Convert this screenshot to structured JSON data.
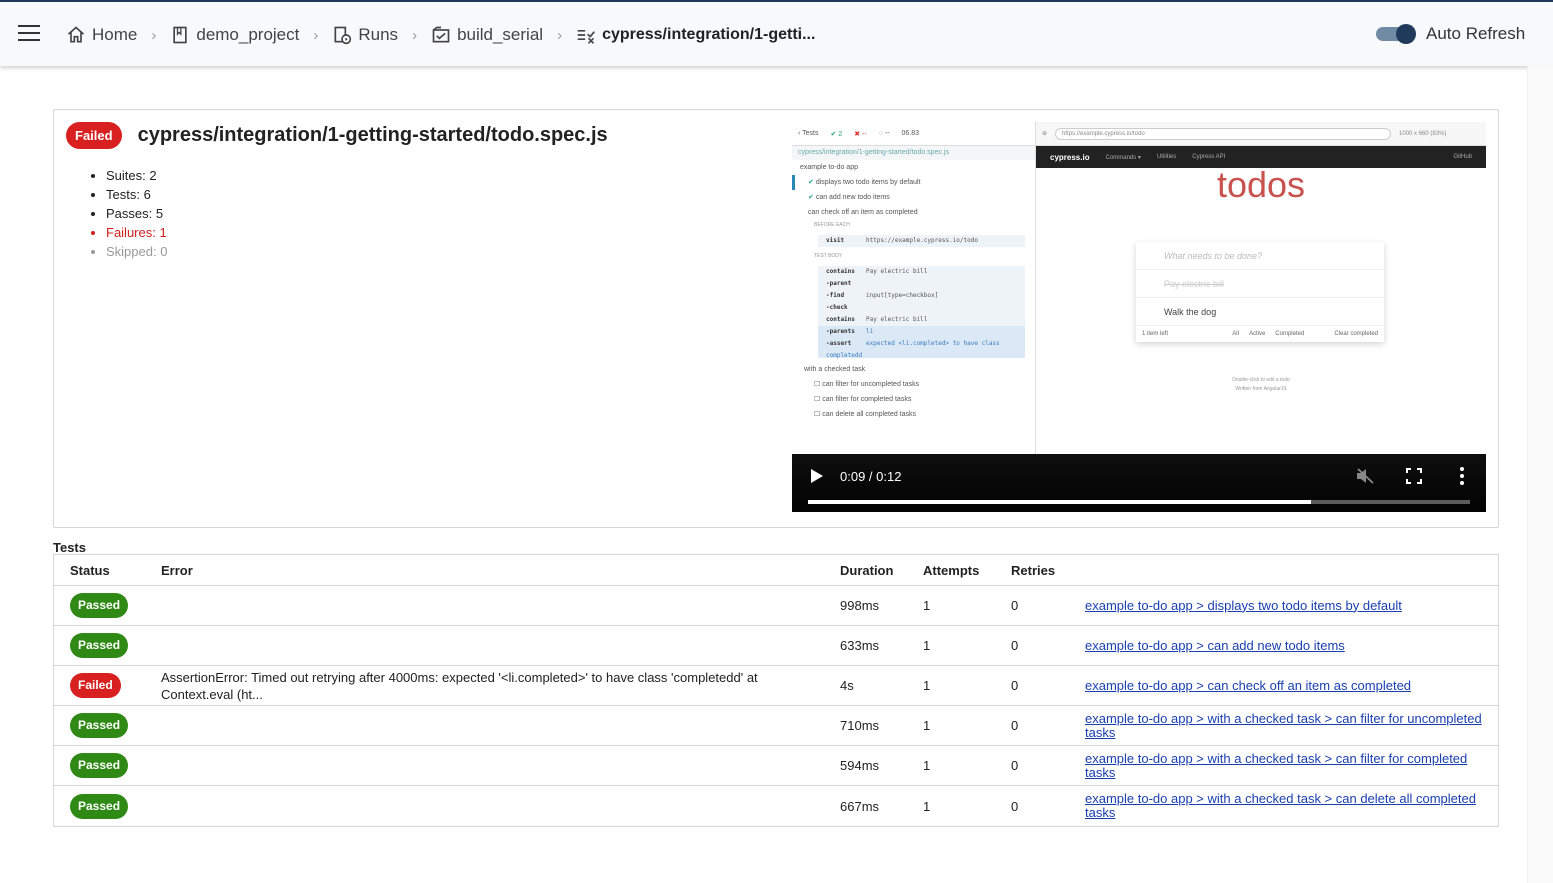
{
  "header": {
    "breadcrumbs": [
      {
        "label": "Home",
        "icon": "home-icon"
      },
      {
        "label": "demo_project",
        "icon": "bookmark-icon"
      },
      {
        "label": "Runs",
        "icon": "runs-icon"
      },
      {
        "label": "build_serial",
        "icon": "build-icon"
      },
      {
        "label": "cypress/integration/1-getti...",
        "icon": "spec-icon"
      }
    ],
    "auto_refresh_label": "Auto Refresh",
    "auto_refresh_on": true
  },
  "spec": {
    "status": "Failed",
    "title": "cypress/integration/1-getting-started/todo.spec.js",
    "stats": {
      "suites": "Suites: 2",
      "tests": "Tests: 6",
      "passes": "Passes: 5",
      "failures": "Failures: 1",
      "skipped": "Skipped: 0"
    }
  },
  "video": {
    "time": "0:09 / 0:12",
    "progress": 0.76,
    "runner": {
      "tests_link": "Tests",
      "passed_count": "2",
      "failed_count": "--",
      "pending_count": "--",
      "duration": "06.83",
      "spec_path": "cypress/integration/1-getting-started/todo.spec.js",
      "suite": "example to-do app",
      "items": [
        "displays two todo items by default",
        "can add new todo items",
        "can check off an item as completed"
      ],
      "before_each": "BEFORE EACH",
      "visit_cmd": "visit",
      "visit_url": "https://example.cypress.io/todo",
      "test_body": "TEST BODY",
      "commands": [
        {
          "name": "contains",
          "arg": "Pay electric bill"
        },
        {
          "name": "-parent",
          "arg": ""
        },
        {
          "name": "-find",
          "arg": "input[type=checkbox]"
        },
        {
          "name": "-check",
          "arg": ""
        },
        {
          "name": "contains",
          "arg": "Pay electric bill"
        },
        {
          "name": "-parents",
          "arg": "li"
        },
        {
          "name": "-assert",
          "arg": "expected <li.completed> to have class completedd"
        }
      ],
      "sub_suite": "with a checked task",
      "sub_items": [
        "can filter for uncompleted tasks",
        "can filter for completed tasks",
        "can delete all completed tasks"
      ]
    },
    "app": {
      "url": "https://example.cypress.io/todo",
      "viewport": "1000 x 660 (83%)",
      "brand": "cypress.io",
      "nav": [
        "Commands ▾",
        "Utilities",
        "Cypress API"
      ],
      "github": "GitHub",
      "title": "todos",
      "placeholder": "What needs to be done?",
      "todos": [
        "Pay electric bill",
        "Walk the dog"
      ],
      "items_left": "1 item left",
      "filters": [
        "All",
        "Active",
        "Completed"
      ],
      "clear": "Clear completed",
      "info1": "Double-click to edit a todo",
      "info2": "Written from AngularJS"
    }
  },
  "tests": {
    "label": "Tests",
    "columns": [
      "Status",
      "Error",
      "Duration",
      "Attempts",
      "Retries"
    ],
    "rows": [
      {
        "status": "Passed",
        "error": "",
        "duration": "998ms",
        "attempts": "1",
        "retries": "0",
        "link": "example to-do app > displays two todo items by default"
      },
      {
        "status": "Passed",
        "error": "",
        "duration": "633ms",
        "attempts": "1",
        "retries": "0",
        "link": "example to-do app > can add new todo items"
      },
      {
        "status": "Failed",
        "error": "AssertionError: Timed out retrying after 4000ms: expected '<li.completed>' to have class 'completedd' at Context.eval (ht...",
        "duration": "4s",
        "attempts": "1",
        "retries": "0",
        "link": "example to-do app > can check off an item as completed"
      },
      {
        "status": "Passed",
        "error": "",
        "duration": "710ms",
        "attempts": "1",
        "retries": "0",
        "link": "example to-do app > with a checked task > can filter for uncompleted tasks"
      },
      {
        "status": "Passed",
        "error": "",
        "duration": "594ms",
        "attempts": "1",
        "retries": "0",
        "link": "example to-do app > with a checked task > can filter for completed tasks"
      },
      {
        "status": "Passed",
        "error": "",
        "duration": "667ms",
        "attempts": "1",
        "retries": "0",
        "link": "example to-do app > with a checked task > can delete all completed tasks"
      }
    ]
  },
  "colors": {
    "failed": "#d7201f",
    "passed": "#2f8a15",
    "link": "#1a3fb0",
    "toggle": "#1f3a5a"
  }
}
